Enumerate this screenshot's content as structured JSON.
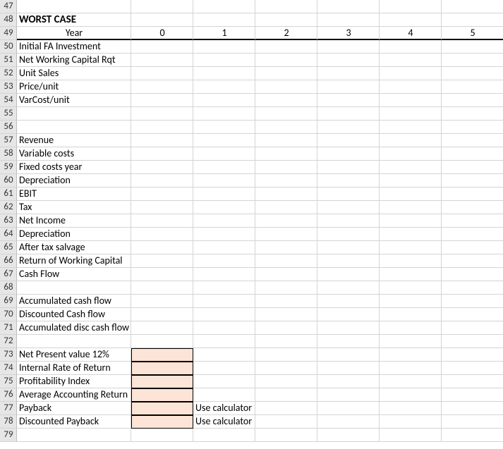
{
  "title": "WORST CASE",
  "columns": {
    "year_label": "Year",
    "years": [
      "0",
      "1",
      "2",
      "3",
      "4",
      "5"
    ]
  },
  "rows": [
    {
      "n": 47,
      "label": "",
      "cells": [
        "",
        "",
        "",
        "",
        "",
        ""
      ]
    },
    {
      "n": 48,
      "label": "WORST CASE",
      "cells": [
        "",
        "",
        "",
        "",
        "",
        ""
      ],
      "is_title": true
    },
    {
      "n": 49,
      "label": "Year",
      "cells": [
        "0",
        "1",
        "2",
        "3",
        "4",
        "5"
      ],
      "is_header": true
    },
    {
      "n": 50,
      "label": "Initial FA Investment",
      "cells": [
        "",
        "",
        "",
        "",
        "",
        ""
      ]
    },
    {
      "n": 51,
      "label": "Net Working Capital Rqt",
      "cells": [
        "",
        "",
        "",
        "",
        "",
        ""
      ]
    },
    {
      "n": 52,
      "label": "Unit Sales",
      "cells": [
        "",
        "",
        "",
        "",
        "",
        ""
      ]
    },
    {
      "n": 53,
      "label": "Price/unit",
      "cells": [
        "",
        "",
        "",
        "",
        "",
        ""
      ]
    },
    {
      "n": 54,
      "label": "VarCost/unit",
      "cells": [
        "",
        "",
        "",
        "",
        "",
        ""
      ]
    },
    {
      "n": 55,
      "label": "",
      "cells": [
        "",
        "",
        "",
        "",
        "",
        ""
      ]
    },
    {
      "n": 56,
      "label": "",
      "cells": [
        "",
        "",
        "",
        "",
        "",
        ""
      ]
    },
    {
      "n": 57,
      "label": "Revenue",
      "cells": [
        "",
        "",
        "",
        "",
        "",
        ""
      ]
    },
    {
      "n": 58,
      "label": "Variable costs",
      "cells": [
        "",
        "",
        "",
        "",
        "",
        ""
      ]
    },
    {
      "n": 59,
      "label": "Fixed costs year",
      "cells": [
        "",
        "",
        "",
        "",
        "",
        ""
      ]
    },
    {
      "n": 60,
      "label": "Depreciation",
      "cells": [
        "",
        "",
        "",
        "",
        "",
        ""
      ]
    },
    {
      "n": 61,
      "label": "EBIT",
      "cells": [
        "",
        "",
        "",
        "",
        "",
        ""
      ]
    },
    {
      "n": 62,
      "label": "Tax",
      "cells": [
        "",
        "",
        "",
        "",
        "",
        ""
      ]
    },
    {
      "n": 63,
      "label": "Net Income",
      "cells": [
        "",
        "",
        "",
        "",
        "",
        ""
      ]
    },
    {
      "n": 64,
      "label": "Depreciation",
      "cells": [
        "",
        "",
        "",
        "",
        "",
        ""
      ]
    },
    {
      "n": 65,
      "label": "After tax salvage",
      "cells": [
        "",
        "",
        "",
        "",
        "",
        ""
      ]
    },
    {
      "n": 66,
      "label": "Return of Working Capital",
      "cells": [
        "",
        "",
        "",
        "",
        "",
        ""
      ]
    },
    {
      "n": 67,
      "label": "Cash Flow",
      "cells": [
        "",
        "",
        "",
        "",
        "",
        ""
      ]
    },
    {
      "n": 68,
      "label": "",
      "cells": [
        "",
        "",
        "",
        "",
        "",
        ""
      ]
    },
    {
      "n": 69,
      "label": "Accumulated cash flow",
      "cells": [
        "",
        "",
        "",
        "",
        "",
        ""
      ]
    },
    {
      "n": 70,
      "label": "Discounted Cash flow",
      "cells": [
        "",
        "",
        "",
        "",
        "",
        ""
      ]
    },
    {
      "n": 71,
      "label": "Accumulated disc cash flow",
      "cells": [
        "",
        "",
        "",
        "",
        "",
        ""
      ]
    },
    {
      "n": 72,
      "label": "",
      "cells": [
        "",
        "",
        "",
        "",
        "",
        ""
      ]
    },
    {
      "n": 73,
      "label": "Net Present value 12%",
      "cells": [
        "",
        "",
        "",
        "",
        "",
        ""
      ],
      "peach": true,
      "box": "top"
    },
    {
      "n": 74,
      "label": "Internal Rate of Return",
      "cells": [
        "",
        "",
        "",
        "",
        "",
        ""
      ],
      "peach": true,
      "box": "mid"
    },
    {
      "n": 75,
      "label": "Profitability Index",
      "cells": [
        "",
        "",
        "",
        "",
        "",
        ""
      ],
      "peach": true,
      "box": "mid"
    },
    {
      "n": 76,
      "label": "Average Accounting Return",
      "cells": [
        "",
        "",
        "",
        "",
        "",
        ""
      ],
      "peach": true,
      "box": "mid"
    },
    {
      "n": 77,
      "label": "Payback",
      "cells": [
        "",
        "Use calculator",
        "",
        "",
        "",
        ""
      ],
      "peach": true,
      "box": "mid"
    },
    {
      "n": 78,
      "label": "Discounted Payback",
      "cells": [
        "",
        "Use calculator",
        "",
        "",
        "",
        ""
      ],
      "peach": true,
      "box": "bot"
    },
    {
      "n": 79,
      "label": "",
      "cells": [
        "",
        "",
        "",
        "",
        "",
        ""
      ]
    }
  ]
}
